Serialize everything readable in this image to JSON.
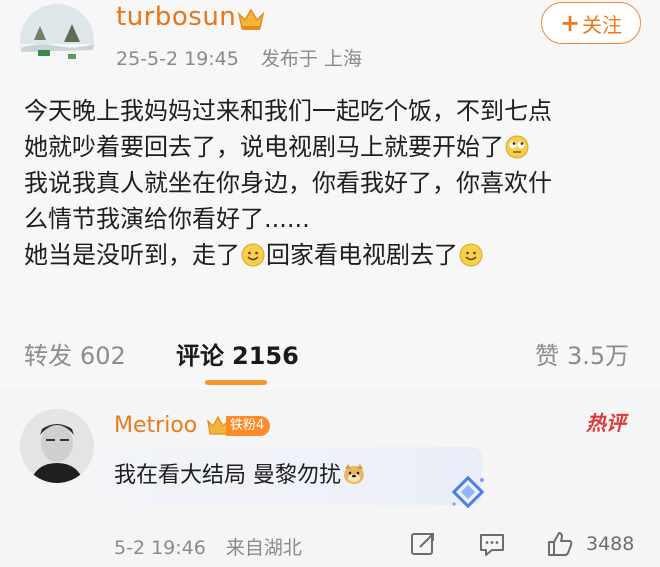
{
  "post": {
    "username": "turbosun",
    "date": "25-5-2 19:45",
    "location": "发布于 上海",
    "follow_label": "关注",
    "follow_plus": "+",
    "lines": [
      "今天晚上我妈妈过来和我们一起吃个饭，不到七点",
      "她就吵着要回去了，说电视剧马上就要开始了",
      "我说我真人就坐在你身边，你看我好了，你喜欢什",
      "么情节我演给你看好了......",
      "她当是没听到，走了",
      "回家看电视剧去了"
    ]
  },
  "stats": {
    "repost_label": "转发",
    "repost_count": "602",
    "comment_label": "评论",
    "comment_count": "2156",
    "like_label": "赞",
    "like_count": "3.5万"
  },
  "comment": {
    "username": "Metrioo",
    "fan_badge": "铁粉4",
    "hot_tag": "热评",
    "text": "我在看大结局 曼黎勿扰",
    "date": "5-2 19:46",
    "location": "来自湖北",
    "like_count": "3488"
  },
  "icons": {
    "emoji_rolling_eyes": "rolling-eyes-emoji",
    "emoji_smile": "smile-emoji",
    "emoji_doge": "doge-emoji",
    "share": "share-icon",
    "comment": "comment-icon",
    "like": "thumbs-up-icon"
  },
  "colors": {
    "accent_orange": "#e8751a",
    "tab_indicator": "#f29a2b",
    "hot_red": "#e03a3a"
  }
}
